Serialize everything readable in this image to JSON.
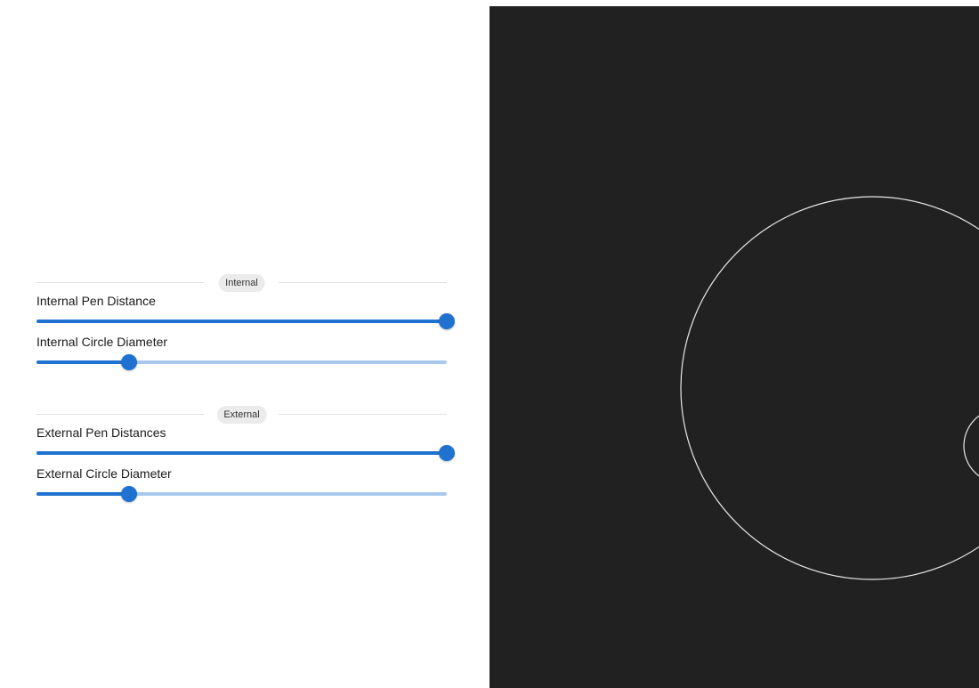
{
  "internal": {
    "section_label": "Internal",
    "pen_distance": {
      "label": "Internal Pen Distance",
      "value": 1.0
    },
    "circle_diameter": {
      "label": "Internal Circle Diameter",
      "value": 0.225
    }
  },
  "external": {
    "section_label": "External",
    "pen_distance": {
      "label": "External Pen Distances",
      "value": 1.0
    },
    "circle_diameter": {
      "label": "External Circle Diameter",
      "value": 0.225
    }
  },
  "colors": {
    "slider_active": "#1f72d0",
    "slider_rail": "#a9c9ec",
    "canvas_background": "#212121",
    "canvas_stroke": "#e8e8e8"
  }
}
